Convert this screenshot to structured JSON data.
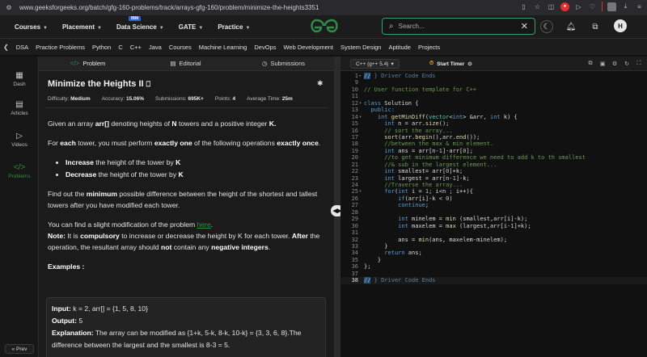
{
  "browser": {
    "url": "www.geeksforgeeks.org/batch/gfg-160-problems/track/arrays-gfg-160/problem/minimize-the-heights3351"
  },
  "header": {
    "nav": [
      {
        "label": "Courses"
      },
      {
        "label": "Placement"
      },
      {
        "label": "Data Science",
        "badge": "IBM"
      },
      {
        "label": "GATE"
      },
      {
        "label": "Practice"
      }
    ],
    "search_placeholder": "Search...",
    "avatar_initial": "H"
  },
  "catnav": [
    "DSA",
    "Practice Problems",
    "Python",
    "C",
    "C++",
    "Java",
    "Courses",
    "Machine Learning",
    "DevOps",
    "Web Development",
    "System Design",
    "Aptitude",
    "Projects"
  ],
  "rail": {
    "items": [
      "Dash",
      "Articles",
      "Videos",
      "Problems"
    ],
    "prev": "Prev"
  },
  "tabs": [
    "Problem",
    "Editorial",
    "Submissions"
  ],
  "problem": {
    "title": "Minimize the Heights II",
    "difficulty_label": "Difficulty:",
    "difficulty": "Medium",
    "accuracy_label": "Accuracy:",
    "accuracy": "15.06%",
    "submissions_label": "Submissions:",
    "submissions": "695K+",
    "points_label": "Points:",
    "points": "4",
    "avgtime_label": "Average Time:",
    "avgtime": "25m",
    "p1_a": "Given an array ",
    "p1_b": "arr[]",
    "p1_c": " denoting heights of ",
    "p1_d": "N",
    "p1_e": " towers and a positive integer ",
    "p1_f": "K.",
    "p2_a": "For ",
    "p2_b": "each",
    "p2_c": " tower, you must perform ",
    "p2_d": "exactly one",
    "p2_e": " of the following operations ",
    "p2_f": "exactly once",
    "p2_g": ".",
    "li1_a": "Increase",
    "li1_b": " the height of the tower by ",
    "li1_c": "K",
    "li2_a": "Decrease",
    "li2_b": " the height of the tower by ",
    "li2_c": "K",
    "p3_a": "Find out the ",
    "p3_b": "minimum",
    "p3_c": " possible difference between the height of the shortest and tallest towers after you have modified each tower.",
    "p4_a": "You can find a slight modification of the problem ",
    "p4_link": "here",
    "p4_b": ".",
    "note_label": "Note:",
    "note_a": " It is ",
    "note_b": "compulsory",
    "note_c": " to increase or decrease the height by K for each tower. ",
    "note_d": "After",
    "note_e": " the operation, the resultant array should ",
    "note_f": "not",
    "note_g": " contain any ",
    "note_h": "negative integers",
    "note_i": ".",
    "examples_heading": "Examples :",
    "ex_input_label": "Input:",
    "ex_input": " k = 2, arr[] = {1, 5, 8, 10}",
    "ex_output_label": "Output:",
    "ex_output": " 5",
    "ex_expl_label": "Explanation:",
    "ex_expl": " The array can be modified as {1+k, 5-k, 8-k, 10-k} = {3, 3, 6, 8}.The difference between the largest and the smallest is 8-3 = 5."
  },
  "editor": {
    "language": "C++ (g++ 5.4)",
    "start_timer": "Start Timer",
    "lines": [
      {
        "n": "1",
        "fold": "▸",
        "text": "// } Driver Code Ends",
        "cls": "ghost",
        "sel": "//"
      },
      {
        "n": "9",
        "text": ""
      },
      {
        "n": "10",
        "text": "// User function template for C++",
        "cls": "cm"
      },
      {
        "n": "11",
        "text": ""
      },
      {
        "n": "12",
        "fold": "▾",
        "text": "class Solution {",
        "cls": "kwline"
      },
      {
        "n": "13",
        "text": "  public:",
        "cls": "kw"
      },
      {
        "n": "14",
        "fold": "▾",
        "text": "    int getMinDiff(vector<int> &arr, int k) {"
      },
      {
        "n": "15",
        "text": "      int n = arr.size();"
      },
      {
        "n": "16",
        "text": "      // sort the array...",
        "cls": "cm"
      },
      {
        "n": "17",
        "text": "      sort(arr.begin(),arr.end());"
      },
      {
        "n": "18",
        "text": "      //between the max & min element.",
        "cls": "cm"
      },
      {
        "n": "19",
        "text": "      int ans = arr[n-1]-arr[0];"
      },
      {
        "n": "20",
        "text": "      //to get minimum difference we need to add k to th smallest",
        "cls": "cm"
      },
      {
        "n": "21",
        "text": "      //& sub in the largest element...",
        "cls": "cm"
      },
      {
        "n": "22",
        "text": "      int smallest= arr[0]+k;"
      },
      {
        "n": "23",
        "text": "      int largest = arr[n-1]-k;"
      },
      {
        "n": "24",
        "text": "      //Traverse the array...",
        "cls": "cm"
      },
      {
        "n": "25",
        "fold": "▾",
        "text": "      for(int i = 1; i<n ; i++){"
      },
      {
        "n": "26",
        "text": "          if(arr[i]-k < 0)"
      },
      {
        "n": "27",
        "text": "          continue;"
      },
      {
        "n": "28",
        "text": ""
      },
      {
        "n": "29",
        "text": "          int minelem = min (smallest,arr[i]-k);"
      },
      {
        "n": "30",
        "text": "          int maxelem = max (largest,arr[i-1]+k);"
      },
      {
        "n": "31",
        "text": ""
      },
      {
        "n": "32",
        "text": "          ans = min(ans, maxelem-minelem);"
      },
      {
        "n": "33",
        "text": "      }"
      },
      {
        "n": "34",
        "text": "      return ans;"
      },
      {
        "n": "35",
        "text": "    }"
      },
      {
        "n": "36",
        "text": "};"
      },
      {
        "n": "37",
        "text": ""
      },
      {
        "n": "38",
        "text": "// } Driver Code Ends",
        "cls": "ghost",
        "sel": "//",
        "cur": true
      }
    ]
  },
  "colors": {
    "brand_green": "#2f8d46",
    "background": "#121212",
    "panel": "#1b1b1b",
    "editor_bg": "#111111"
  }
}
